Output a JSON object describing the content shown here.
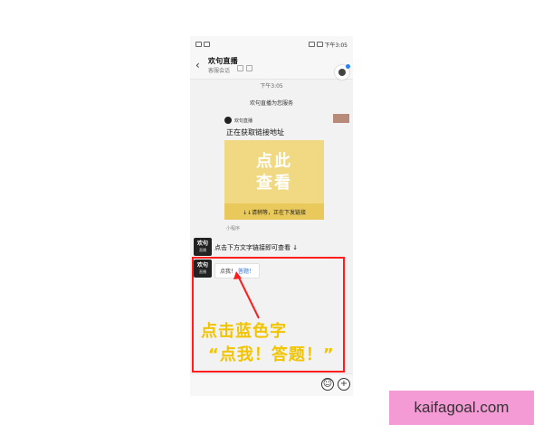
{
  "status_bar": {
    "time": "下午3:05"
  },
  "header": {
    "title": "欢句直播",
    "subtitle": "客服会话"
  },
  "chat": {
    "time_divider": "下午3:05",
    "service_notice": "欢句直播为您服务",
    "card_sender": "欢句直播",
    "status_text": "正在获取链接地址",
    "promo_main_line1": "点此",
    "promo_main_line2": "查看",
    "promo_bar_text": "↓↓请稍等，正在下发链接",
    "mini_link": "小程序",
    "avatar_main": "欢句",
    "avatar_sub": "直播",
    "message1": "点击下方文字链接即可查看 ↓",
    "message2_prefix": "点我！",
    "message2_link": "答题！"
  },
  "annotation": {
    "line1": "点击蓝色字",
    "line2": "“点我！答题！”",
    "color": "#f2c400",
    "box_color": "#ff1d1d"
  },
  "watermark": {
    "text": "kaifagoal.com",
    "background": "#f49bd5"
  },
  "icons": {
    "back": "chevron-left-icon",
    "emoji": "emoji-icon",
    "plus": "plus-icon"
  }
}
